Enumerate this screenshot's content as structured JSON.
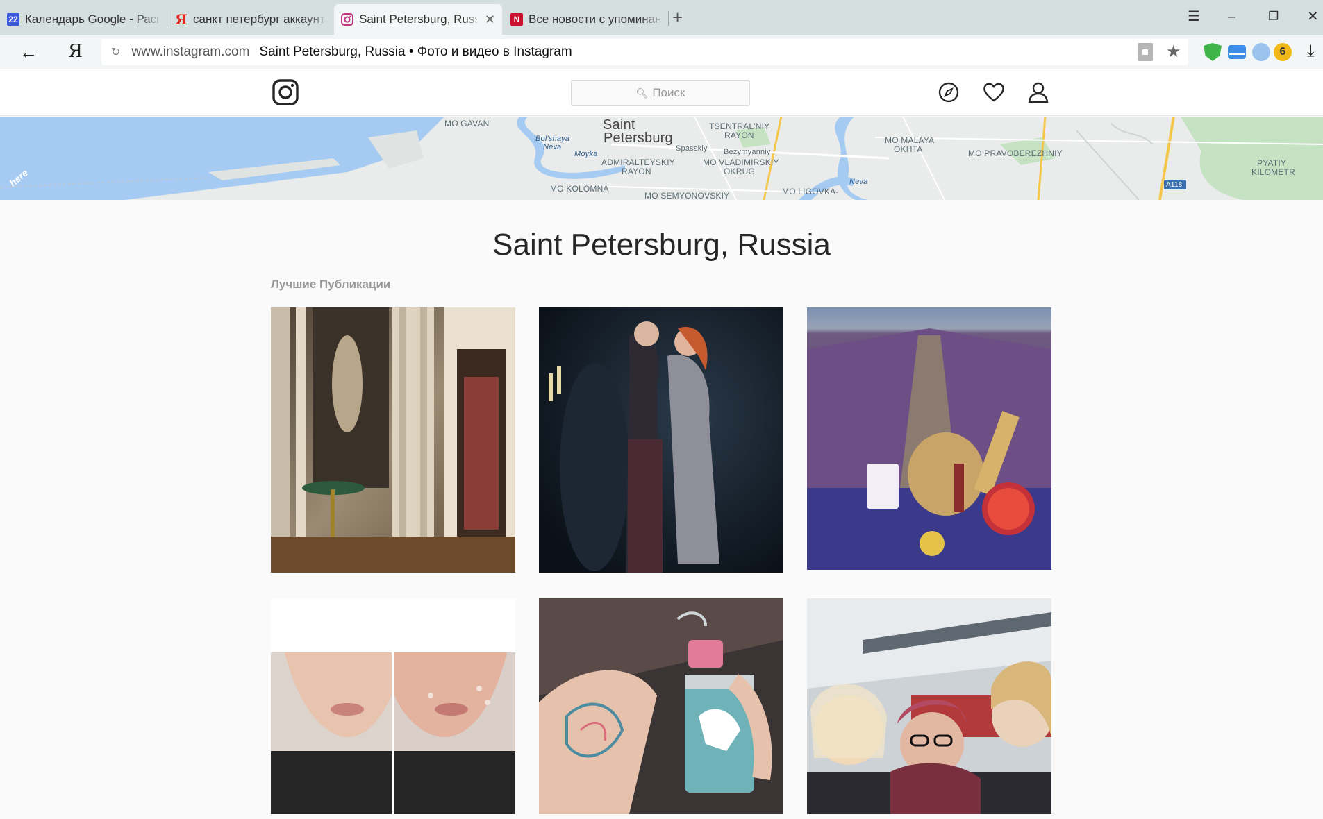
{
  "browser": {
    "tabs": [
      {
        "label": "Календарь Google - Распис",
        "icon_text": "22",
        "icon_color": "#3b5bdb"
      },
      {
        "label": "санкт петербург аккаунт ин",
        "icon_text": "Я",
        "icon_color": "#e52620"
      },
      {
        "label": "Saint Petersburg, Russia •",
        "icon_text": "",
        "icon_color": "#c13584"
      },
      {
        "label": "Все новости с упоминание",
        "icon_text": "N",
        "icon_color": "#c8102e"
      }
    ],
    "address": {
      "domain": "www.instagram.com",
      "page_title": "Saint Petersburg, Russia • Фото и видео в Instagram"
    },
    "extension_badge": "6"
  },
  "instagram": {
    "search_placeholder": "Поиск",
    "location_title": "Saint Petersburg, Russia",
    "section_title": "Лучшие Публикации"
  },
  "map": {
    "logo": "here",
    "labels": [
      {
        "text": "MO GAVAN'",
        "kind": "district"
      },
      {
        "text": "Saint",
        "kind": "city"
      },
      {
        "text": "Petersburg",
        "kind": "city"
      },
      {
        "text": "TSENTRAL'NIY",
        "kind": "district"
      },
      {
        "text": "RAYON",
        "kind": "district"
      },
      {
        "text": "Bol'shaya",
        "kind": "water"
      },
      {
        "text": "Neva",
        "kind": "water"
      },
      {
        "text": "Moyka",
        "kind": "water"
      },
      {
        "text": "Spasskiy",
        "kind": "district"
      },
      {
        "text": "Bezymyanniy",
        "kind": "district"
      },
      {
        "text": "ADMIRALTEYSKIY",
        "kind": "district"
      },
      {
        "text": "RAYON",
        "kind": "district"
      },
      {
        "text": "MO VLADIMIRSKIY",
        "kind": "district"
      },
      {
        "text": "OKRUG",
        "kind": "district"
      },
      {
        "text": "MO MALAYA",
        "kind": "district"
      },
      {
        "text": "OKHTA",
        "kind": "district"
      },
      {
        "text": "MO PRAVOBEREZHNIY",
        "kind": "district"
      },
      {
        "text": "PYATIY",
        "kind": "district"
      },
      {
        "text": "KILOMETR",
        "kind": "district"
      },
      {
        "text": "MO KOLOMNA",
        "kind": "district"
      },
      {
        "text": "MO SEMYONOVSKIY",
        "kind": "district"
      },
      {
        "text": "MO LIGOVKA-",
        "kind": "district"
      },
      {
        "text": "Neva",
        "kind": "water"
      },
      {
        "text": "A118",
        "kind": "road"
      }
    ]
  },
  "posts": [
    {
      "name": "post-palace-interior",
      "subject": "palace interior with statue and columns"
    },
    {
      "name": "post-dancing-couple",
      "subject": "couple dancing on stage"
    },
    {
      "name": "post-lavender-picnic",
      "subject": "lavender field picnic"
    },
    {
      "name": "post-face-comparison",
      "subject": "before and after face photos"
    },
    {
      "name": "post-tattoo-can",
      "subject": "tattooed arm holding a can"
    },
    {
      "name": "post-train-selfie",
      "subject": "group selfie at a train platform"
    }
  ],
  "colors": {
    "accent": "#262626",
    "map_water": "#a6cbf2",
    "map_land": "#e9ecea",
    "map_park": "#c5e3c3",
    "map_road": "#f5c64c"
  }
}
